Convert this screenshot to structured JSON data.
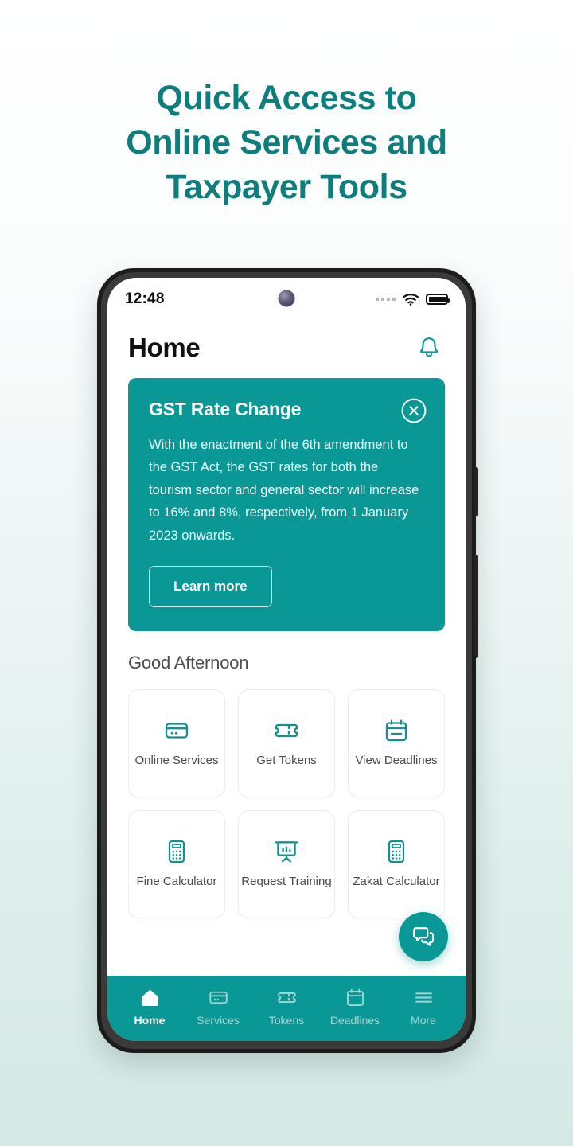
{
  "headline": {
    "lines": [
      "Quick Access to",
      "Online Services and",
      "Taxpayer Tools"
    ],
    "color": "#0d7e7c"
  },
  "theme": {
    "accent": "#0a9896",
    "accent_dark": "#0d7e7c",
    "text_dark": "#111111",
    "text_muted": "#4a4a4a",
    "screen_bg": "#ffffff"
  },
  "phone": {
    "status_bar": {
      "time": "12:48",
      "camera_icon": "punch-hole-camera-icon",
      "signal_icon": "signal-dots-icon",
      "wifi_icon": "wifi-icon",
      "battery_icon": "battery-full-icon"
    },
    "app_header": {
      "title": "Home",
      "notification_icon": "bell-icon"
    },
    "banner": {
      "title": "GST Rate Change",
      "close_icon": "close-circle-icon",
      "body": "With the enactment of the 6th amendment to the GST Act, the GST rates for both the tourism sector and general sector will increase to 16% and 8%, respectively, from 1 January 2023 onwards.",
      "cta_label": "Learn more",
      "background": "#0a9896"
    },
    "greeting": "Good Afternoon",
    "tiles": [
      {
        "label": "Online Services",
        "icon": "card-icon"
      },
      {
        "label": "Get Tokens",
        "icon": "ticket-icon"
      },
      {
        "label": "View Deadlines",
        "icon": "calendar-icon"
      },
      {
        "label": "Fine Calculator",
        "icon": "calculator-icon"
      },
      {
        "label": "Request Training",
        "icon": "presentation-chart-icon"
      },
      {
        "label": "Zakat Calculator",
        "icon": "calculator-icon"
      }
    ],
    "chat_fab": {
      "icon": "chat-bubbles-icon",
      "label": "Chat"
    },
    "bottom_nav": [
      {
        "label": "Home",
        "icon": "home-icon",
        "active": true
      },
      {
        "label": "Services",
        "icon": "card-icon",
        "active": false
      },
      {
        "label": "Tokens",
        "icon": "ticket-icon",
        "active": false
      },
      {
        "label": "Deadlines",
        "icon": "calendar-icon",
        "active": false
      },
      {
        "label": "More",
        "icon": "hamburger-icon",
        "active": false
      }
    ]
  }
}
